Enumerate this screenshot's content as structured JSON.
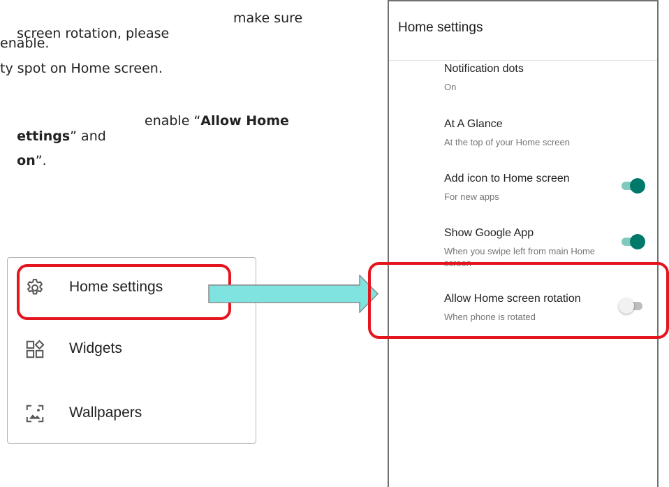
{
  "instructions": {
    "line1_a": "screen rotation, please",
    "line1_b": "make sure",
    "line2": "enable.",
    "line3": "ty spot on Home screen.",
    "line4_bold": "ettings",
    "line4_mid": "” and",
    "line4_tail_a": "enable “",
    "line4_tail_bold": "Allow Home",
    "line5_bold": "on",
    "line5_end": "”."
  },
  "menu": {
    "items": [
      {
        "label": "Home settings",
        "icon": "gear-icon"
      },
      {
        "label": "Widgets",
        "icon": "widgets-icon"
      },
      {
        "label": "Wallpapers",
        "icon": "wallpaper-icon"
      }
    ]
  },
  "phone": {
    "title": "Home settings",
    "settings": [
      {
        "title": "Notification dots",
        "subtitle": "On"
      },
      {
        "title": "At A Glance",
        "subtitle": "At the top of your Home screen"
      },
      {
        "title": "Add icon to Home screen",
        "subtitle": "For new apps",
        "toggle": "on"
      },
      {
        "title": "Show Google App",
        "subtitle": "When you swipe left from main Home screen",
        "toggle": "on"
      },
      {
        "title": "Allow Home screen rotation",
        "subtitle": "When phone is rotated",
        "toggle": "off"
      }
    ]
  },
  "colors": {
    "highlight": "#e4151f",
    "toggle_on": "#00796b",
    "arrow_fill": "#7fe3e0"
  }
}
